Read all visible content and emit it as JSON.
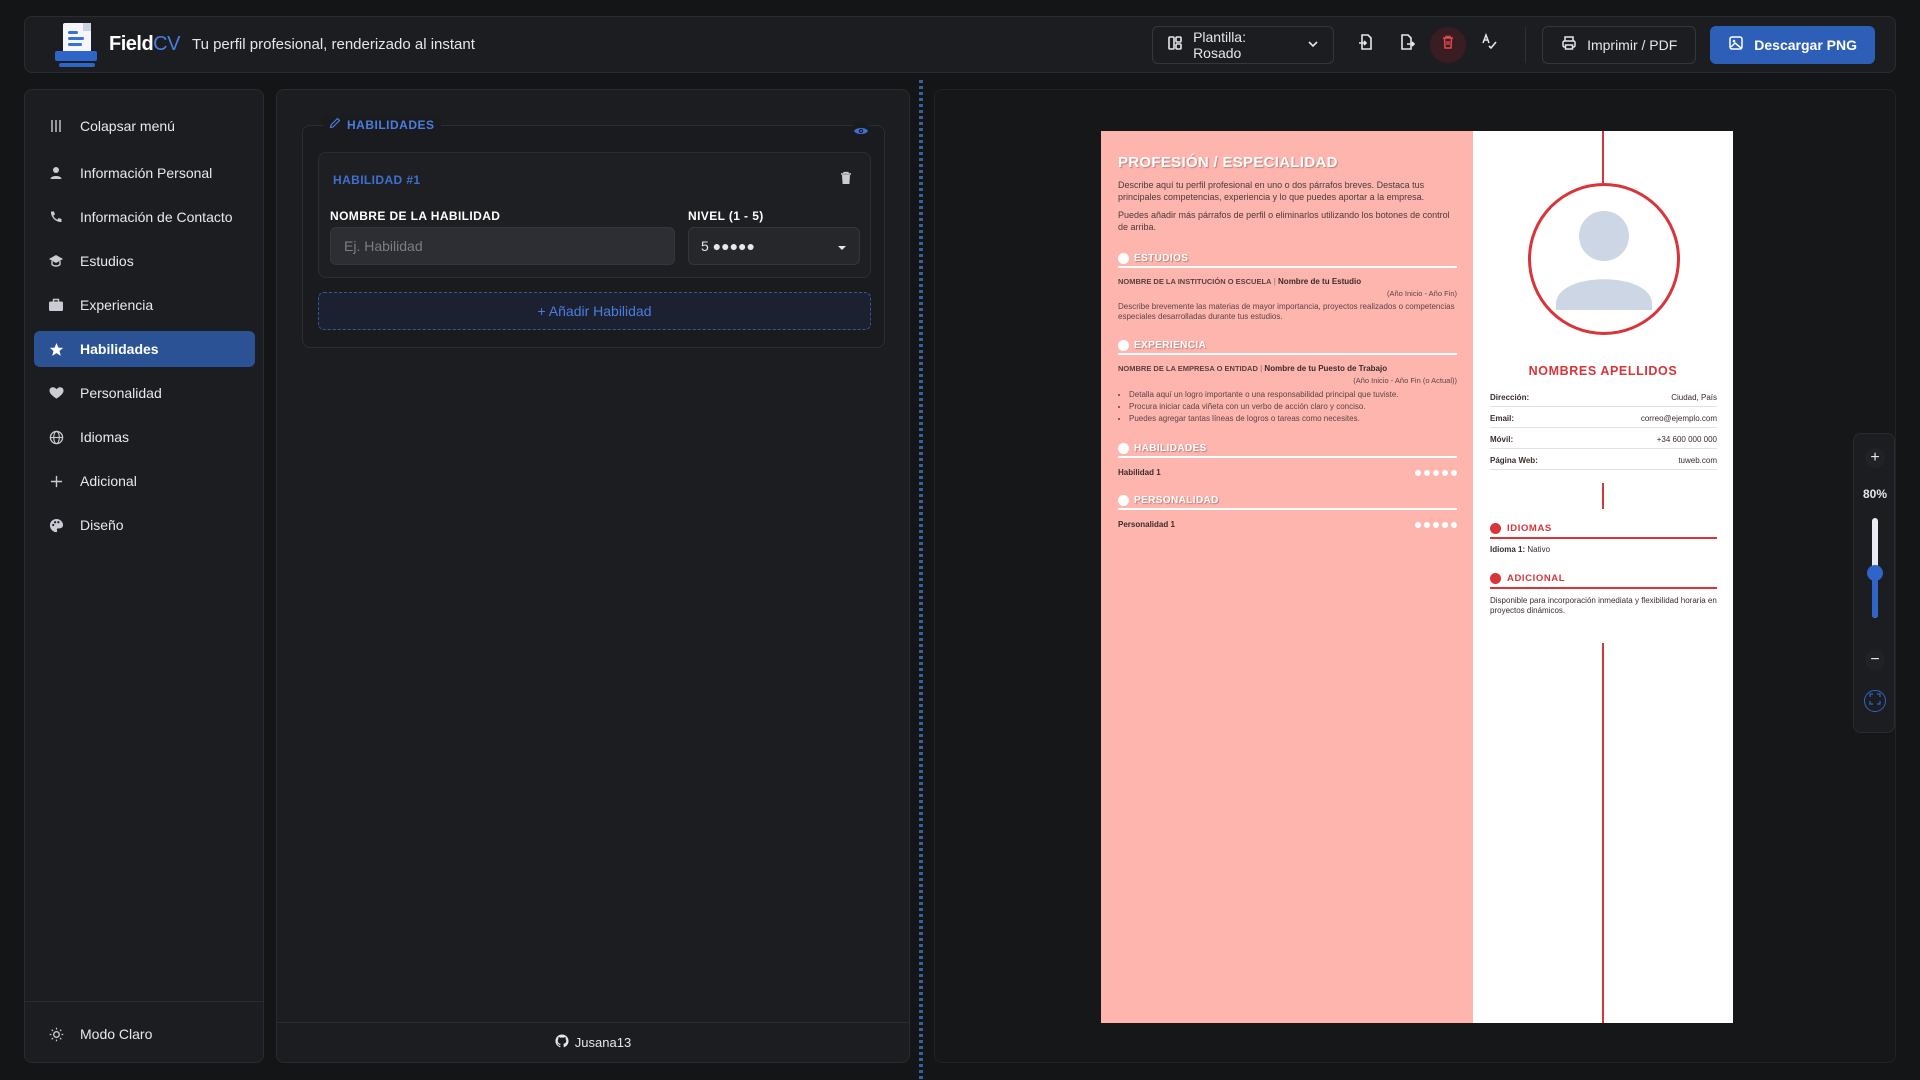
{
  "header": {
    "brand_name": "Field",
    "brand_suffix": "CV",
    "tagline": "Tu perfil profesional, renderizado al instant",
    "template_label": "Plantilla: Rosado",
    "print_label": "Imprimir / PDF",
    "download_label": "Descargar PNG"
  },
  "sidebar": {
    "collapse_label": "Colapsar menú",
    "items": [
      {
        "label": "Información Personal",
        "icon": "user-icon"
      },
      {
        "label": "Información de Contacto",
        "icon": "phone-icon"
      },
      {
        "label": "Estudios",
        "icon": "graduation-cap-icon"
      },
      {
        "label": "Experiencia",
        "icon": "briefcase-icon"
      },
      {
        "label": "Habilidades",
        "icon": "star-icon",
        "active": true
      },
      {
        "label": "Personalidad",
        "icon": "heart-icon"
      },
      {
        "label": "Idiomas",
        "icon": "globe-icon"
      },
      {
        "label": "Adicional",
        "icon": "plus-icon"
      },
      {
        "label": "Diseño",
        "icon": "palette-icon"
      }
    ],
    "theme_toggle_label": "Modo Claro"
  },
  "editor": {
    "section_title": "HABILIDADES",
    "skill_title": "HABILIDAD #1",
    "name_label": "NOMBRE DE LA HABILIDAD",
    "name_placeholder": "Ej. Habilidad",
    "name_value": "",
    "level_label": "NIVEL (1 - 5)",
    "level_value": "5 ●●●●●",
    "add_label": "+ Añadir Habilidad",
    "footer_user": "Jusana13"
  },
  "cv": {
    "profession": "PROFESIÓN / ESPECIALIDAD",
    "summary_1": "Describe aquí tu perfil profesional en uno o dos párrafos breves. Destaca tus principales competencias, experiencia y lo que puedes aportar a la empresa.",
    "summary_2": "Puedes añadir más párrafos de perfil o eliminarlos utilizando los botones de control de arriba.",
    "studies_title": "ESTUDIOS",
    "studies_institution": "NOMBRE DE LA INSTITUCIÓN O ESCUELA",
    "studies_name": "Nombre de tu Estudio",
    "studies_dates": "(Año Inicio - Año Fin)",
    "studies_desc": "Describe brevemente las materias de mayor importancia, proyectos realizados o competencias especiales desarrolladas durante tus estudios.",
    "experience_title": "EXPERIENCIA",
    "experience_company": "NOMBRE DE LA EMPRESA O ENTIDAD",
    "experience_role": "Nombre de tu Puesto de Trabajo",
    "experience_dates": "(Año Inicio - Año Fin (o Actual))",
    "experience_bullets": [
      "Detalla aquí un logro importante o una responsabilidad principal que tuviste.",
      "Procura iniciar cada viñeta con un verbo de acción claro y conciso.",
      "Puedes agregar tantas líneas de logros o tareas como necesites."
    ],
    "skills_title": "HABILIDADES",
    "skill_1": "Habilidad 1",
    "skill_1_level": 5,
    "personality_title": "PERSONALIDAD",
    "personality_1": "Personalidad 1",
    "personality_1_level": 5,
    "name": "NOMBRES APELLIDOS",
    "contact": [
      {
        "label": "Dirección:",
        "value": "Ciudad, País"
      },
      {
        "label": "Email:",
        "value": "correo@ejemplo.com"
      },
      {
        "label": "Móvil:",
        "value": "+34 600 000 000"
      },
      {
        "label": "Página Web:",
        "value": "tuweb.com"
      }
    ],
    "languages_title": "IDIOMAS",
    "language_1_label": "Idioma 1:",
    "language_1_value": "Nativo",
    "additional_title": "ADICIONAL",
    "additional_text": "Disponible para incorporación inmediata y flexibilidad horaria en proyectos dinámicos."
  },
  "zoom": {
    "level": "80%",
    "slider_fraction": 0.45
  },
  "colors": {
    "accent": "#2d5fb8",
    "cv_left": "#feb5ae",
    "cv_red": "#d8343a",
    "bg": "#141517"
  }
}
